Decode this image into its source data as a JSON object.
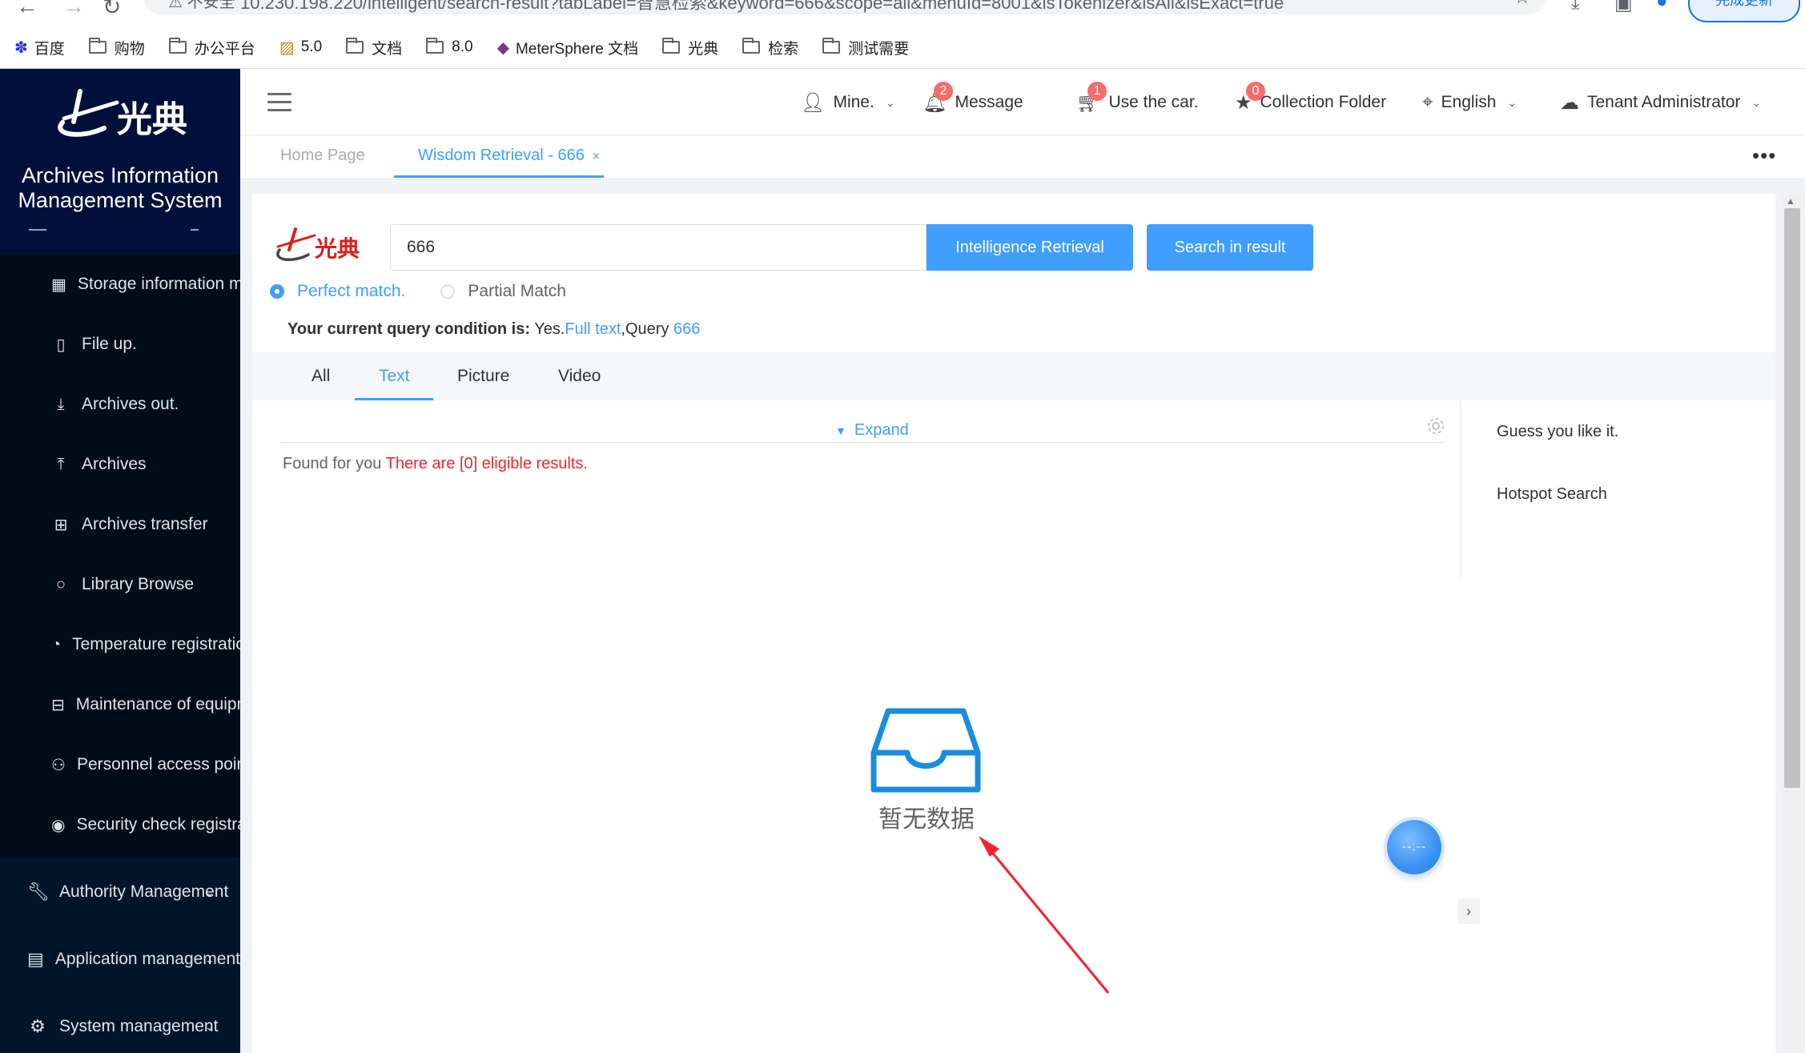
{
  "browser": {
    "insecure_label": "不安全",
    "url": "10.230.198.220/intelligent/search-result?tabLabel=智慧检索&keyword=666&scope=all&menuId=8001&isTokenizer&isAll&isExact=true",
    "update_button": "完成更新",
    "bookmarks": [
      {
        "label": "百度",
        "icon": "baidu-icon"
      },
      {
        "label": "购物",
        "icon": "folder-icon"
      },
      {
        "label": "办公平台",
        "icon": "folder-icon"
      },
      {
        "label": "5.0",
        "icon": "image-icon"
      },
      {
        "label": "文档",
        "icon": "folder-icon"
      },
      {
        "label": "8.0",
        "icon": "folder-icon"
      },
      {
        "label": "MeterSphere 文档",
        "icon": "metersphere-icon"
      },
      {
        "label": "光典",
        "icon": "folder-icon"
      },
      {
        "label": "检索",
        "icon": "folder-icon"
      },
      {
        "label": "测试需要",
        "icon": "folder-icon"
      }
    ]
  },
  "sidebar": {
    "logo_text": "光典",
    "system_title_line1": "Archives Information",
    "system_title_line2": "Management System",
    "submenu": [
      {
        "label": "Storage information management",
        "icon": "building-icon"
      },
      {
        "label": "File up.",
        "icon": "file-icon"
      },
      {
        "label": "Archives out.",
        "icon": "download-icon"
      },
      {
        "label": "Archives",
        "icon": "upload-icon"
      },
      {
        "label": "Archives transfer",
        "icon": "transfer-icon"
      },
      {
        "label": "Library Browse",
        "icon": "search-icon"
      },
      {
        "label": "Temperature registration",
        "icon": "gauge-icon"
      },
      {
        "label": "Maintenance of equipment",
        "icon": "device-icon"
      },
      {
        "label": "Personnel access points",
        "icon": "user-icon"
      },
      {
        "label": "Security check registration",
        "icon": "eye-icon"
      }
    ],
    "top_menu": [
      {
        "label": "Authority Management",
        "icon": "wrench-icon"
      },
      {
        "label": "Application management",
        "icon": "clipboard-icon"
      },
      {
        "label": "System management",
        "icon": "gear-icon"
      }
    ]
  },
  "header": {
    "mine": "Mine.",
    "message": "Message",
    "message_badge": "2",
    "car": "Use the car.",
    "car_badge": "1",
    "collection": "Collection Folder",
    "collection_badge": "0",
    "language": "English",
    "tenant": "Tenant Administrator"
  },
  "tabs": {
    "home": "Home Page",
    "active": "Wisdom Retrieval - 666",
    "close": "×",
    "more": "•••"
  },
  "search": {
    "logo_text": "光典",
    "keyword": "666",
    "intelligence_button": "Intelligence Retrieval",
    "in_result_button": "Search in result",
    "perfect_match": "Perfect match.",
    "partial_match": "Partial Match",
    "match_mode": "perfect",
    "condition_label": "Your current query condition is:",
    "condition_yes": "Yes.",
    "condition_full_text": "Full text",
    "condition_query": ",Query",
    "condition_keyword": "666"
  },
  "type_tabs": [
    "All",
    "Text",
    "Picture",
    "Video"
  ],
  "active_type_tab": "Text",
  "results": {
    "expand": "Expand",
    "found_prefix": "Found for you",
    "found_result": "There are [0] eligible results.",
    "empty_text": "暂无数据"
  },
  "right_panel": {
    "guess": "Guess you like it.",
    "hotspot": "Hotspot Search"
  },
  "float_ball_text": "--:--",
  "colors": {
    "primary": "#409eff",
    "sidebar_bg": "#001529",
    "danger": "#f5222d",
    "badge": "#f56c6c"
  }
}
